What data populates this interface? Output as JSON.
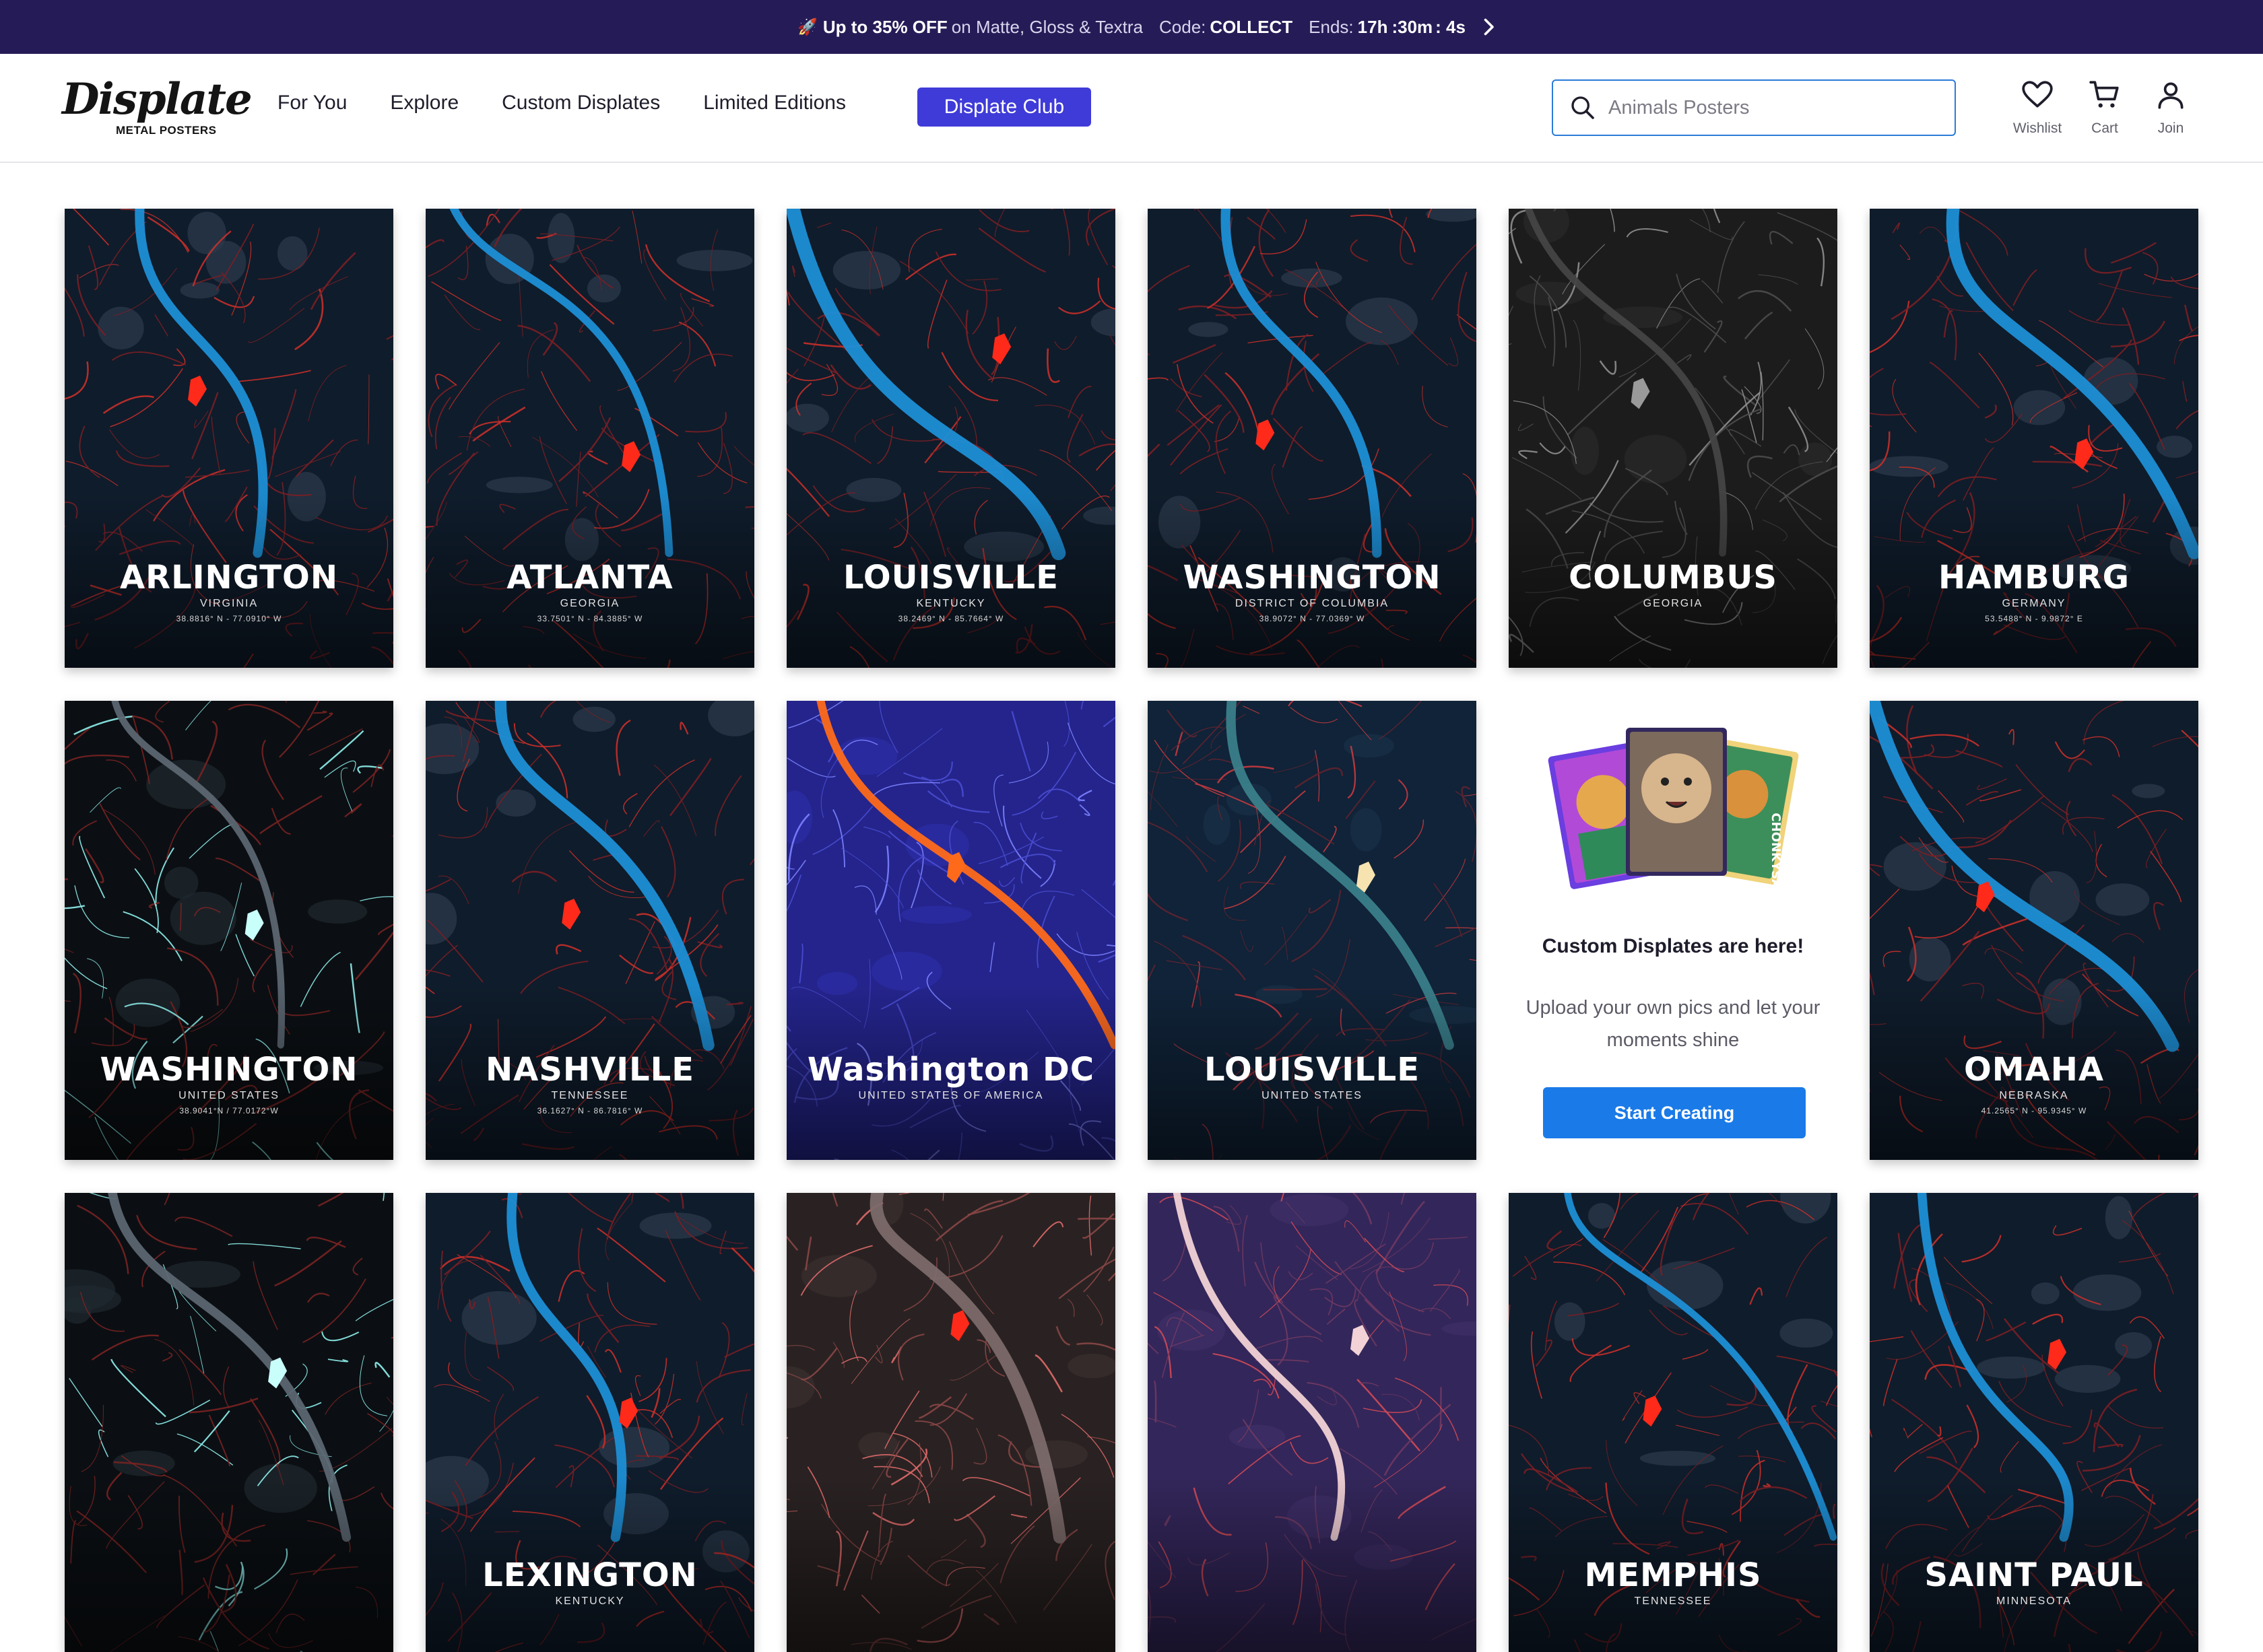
{
  "promo": {
    "rocket": "🚀",
    "deal": "Up to 35% OFF",
    "on_text": "on Matte, Gloss & Textra",
    "code_label": "Code:",
    "code": "COLLECT",
    "ends_label": "Ends:",
    "hours": "17h",
    "minutes": ":30m",
    "seconds": ": 4s"
  },
  "header": {
    "logo_word": "Displate",
    "logo_sub": "METAL POSTERS",
    "nav": [
      "For You",
      "Explore",
      "Custom Displates",
      "Limited Editions"
    ],
    "club_label": "Displate Club",
    "search_placeholder": "Animals Posters",
    "icons": [
      {
        "name": "heart-icon",
        "label": "Wishlist"
      },
      {
        "name": "cart-icon",
        "label": "Cart"
      },
      {
        "name": "user-icon",
        "label": "Join"
      }
    ]
  },
  "cards": [
    {
      "city": "ARLINGTON",
      "region": "VIRGINIA",
      "coords": "38.8816° N - 77.0910° W",
      "palette": "red",
      "river": "blue"
    },
    {
      "city": "ATLANTA",
      "region": "GEORGIA",
      "coords": "33.7501° N - 84.3885° W",
      "palette": "red",
      "river": "blue"
    },
    {
      "city": "LOUISVILLE",
      "region": "KENTUCKY",
      "coords": "38.2469° N - 85.7664° W",
      "palette": "red",
      "river": "blue"
    },
    {
      "city": "WASHINGTON",
      "region": "DISTRICT OF COLUMBIA",
      "coords": "38.9072° N - 77.0369° W",
      "palette": "red",
      "river": "blue"
    },
    {
      "city": "COLUMBUS",
      "region": "GEORGIA",
      "coords": "",
      "palette": "gray",
      "river": "gray"
    },
    {
      "city": "HAMBURG",
      "region": "GERMANY",
      "coords": "53.5488° N - 9.9872° E",
      "palette": "red",
      "river": "blue"
    },
    {
      "city": "WASHINGTON",
      "region": "UNITED STATES",
      "coords": "38.9041°N / 77.0172°W",
      "palette": "cyan",
      "river": "gray"
    },
    {
      "city": "NASHVILLE",
      "region": "TENNESSEE",
      "coords": "36.1627° N - 86.7816° W",
      "palette": "red",
      "river": "blue"
    },
    {
      "city": "Washington DC",
      "region": "UNITED STATES OF AMERICA",
      "coords": "",
      "palette": "indigo",
      "river": "orange"
    },
    {
      "city": "LOUISVILLE",
      "region": "UNITED STATES",
      "coords": "",
      "palette": "navy",
      "river": "teal"
    },
    {
      "promo": true,
      "title": "Custom Displates are here!",
      "desc1": "Upload your own pics and let your",
      "desc2": "moments shine",
      "button": "Start Creating"
    },
    {
      "city": "OMAHA",
      "region": "NEBRASKA",
      "coords": "41.2565° N - 95.9345° W",
      "palette": "red",
      "river": "blue"
    },
    {
      "city": "",
      "region": "",
      "coords": "",
      "palette": "cyan",
      "river": "gray"
    },
    {
      "city": "LEXINGTON",
      "region": "KENTUCKY",
      "coords": "",
      "palette": "red",
      "river": "blue"
    },
    {
      "city": "",
      "region": "",
      "coords": "",
      "palette": "salmon",
      "river": "gray"
    },
    {
      "city": "",
      "region": "",
      "coords": "",
      "palette": "purple",
      "river": "pink"
    },
    {
      "city": "MEMPHIS",
      "region": "TENNESSEE",
      "coords": "",
      "palette": "red",
      "river": "blue"
    },
    {
      "city": "SAINT PAUL",
      "region": "MINNESOTA",
      "coords": "",
      "palette": "red",
      "river": "blue"
    }
  ],
  "colors": {
    "promo_bg": "#251c57",
    "club_bg": "#3f3bd8",
    "start_btn": "#1a7ae8",
    "search_border": "#2a7bd8"
  }
}
